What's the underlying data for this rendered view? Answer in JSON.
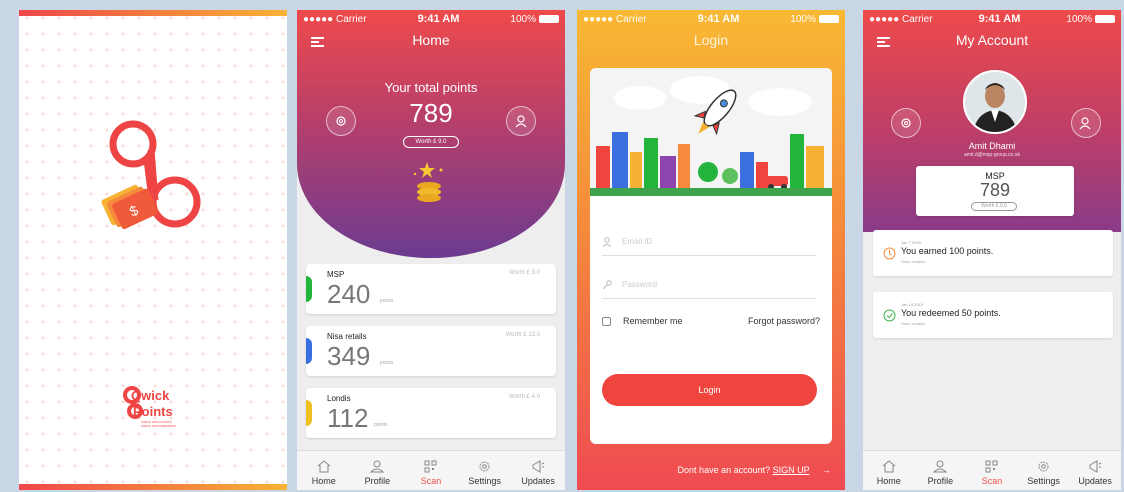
{
  "status": {
    "carrier": "●●●●● Carrier",
    "time": "9:41 AM",
    "battery": "100%"
  },
  "splash": {
    "brand_line1": "Qwick",
    "brand_line2": "Points",
    "tagline1": "QWICK WITH POINTS",
    "tagline2": "QWICK WITH REWARDS"
  },
  "home": {
    "title": "Home",
    "total_label": "Your total points",
    "total_points": "789",
    "total_worth": "Worth £ 9.0",
    "cards": [
      {
        "name": "MSP",
        "worth": "Worth £ 9.0",
        "points": "240",
        "unit": "points",
        "color": "#23b53b"
      },
      {
        "name": "Nisa retails",
        "worth": "Worth £ 13.0",
        "points": "349",
        "unit": "points",
        "color": "#3b6fe0"
      },
      {
        "name": "Londis",
        "worth": "Worth £ 4.0",
        "points": "112",
        "unit": "points",
        "color": "#f0c020"
      }
    ]
  },
  "tabs": [
    {
      "label": "Home",
      "icon": "home-icon"
    },
    {
      "label": "Profile",
      "icon": "profile-icon"
    },
    {
      "label": "Scan",
      "icon": "qr-code-icon"
    },
    {
      "label": "Settings",
      "icon": "gear-icon"
    },
    {
      "label": "Updates",
      "icon": "megaphone-icon"
    }
  ],
  "active_tab": "Scan",
  "login": {
    "title": "Login",
    "email_placeholder": "Email ID",
    "password_placeholder": "Password",
    "remember_label": "Remember me",
    "forgot_label": "Forgot password?",
    "login_button": "Login",
    "signup_prompt": "Dont have an account?",
    "signup_link": "SIGN UP",
    "arrow": "→"
  },
  "account": {
    "title": "My Account",
    "name": "Amit Dhami",
    "email": "amit.d@msp-group.co.uk",
    "card_title": "MSP",
    "card_points": "789",
    "card_worth": "Worth £ 9.0",
    "activities": [
      {
        "date": "Jan 7 2015",
        "message": "You earned 100 points.",
        "location": "Store location",
        "icon": "clock-icon",
        "color": "#f58a3c"
      },
      {
        "date": "Jan 14 2015",
        "message": "You redeemed 50 points.",
        "location": "Store location",
        "icon": "check-icon",
        "color": "#3fb54e"
      }
    ]
  },
  "colors": {
    "accent": "#f0504a",
    "gradient_top": "#ef4a4a",
    "gradient_bottom": "#6c3b90",
    "login_top": "#f8b933"
  }
}
